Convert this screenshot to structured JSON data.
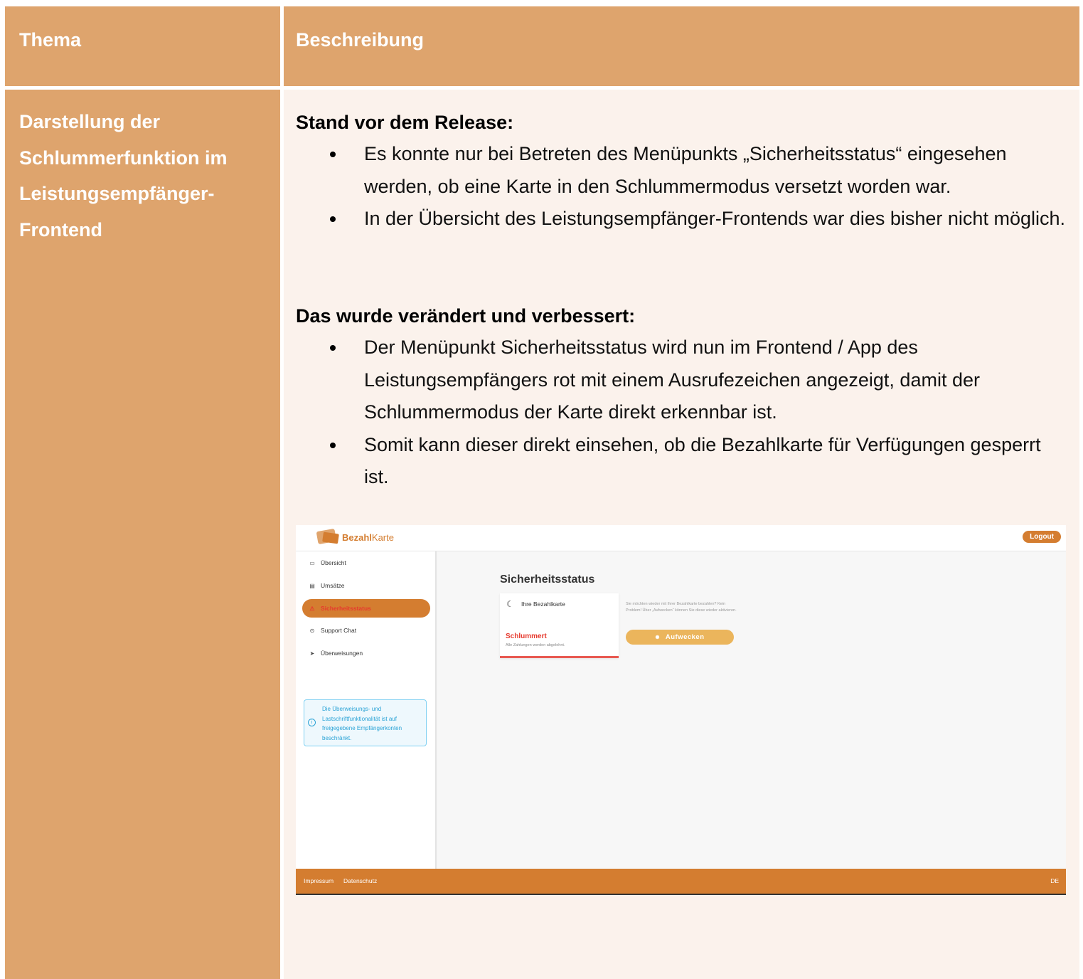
{
  "table": {
    "headers": {
      "topic": "Thema",
      "description": "Beschreibung"
    },
    "topic": "Darstellung der Schlummerfunktion im Leistungsempfänger-Frontend",
    "before": {
      "title": "Stand vor dem Release:",
      "bullets": [
        "Es konnte nur bei Betreten des Menüpunkts „Sicherheitsstatus“ eingesehen werden, ob eine Karte in den Schlummermodus versetzt worden war.",
        "In der Übersicht des Leistungsempfänger-Frontends war dies bisher nicht möglich."
      ]
    },
    "after": {
      "title": "Das wurde verändert und verbessert:",
      "bullets": [
        "Der Menüpunkt Sicherheitsstatus wird nun im Frontend / App des Leistungsempfängers rot mit einem Ausrufezeichen angezeigt, damit der Schlummermodus der Karte direkt erkennbar ist.",
        "Somit kann dieser direkt einsehen, ob die Bezahlkarte für Verfügungen gesperrt ist."
      ]
    }
  },
  "app": {
    "logo_bold": "Bezahl",
    "logo_rest": "Karte",
    "logout": "Logout",
    "nav": [
      {
        "label": "Übersicht",
        "icon": "card-icon"
      },
      {
        "label": "Umsätze",
        "icon": "receipt-icon"
      },
      {
        "label": "Sicherheitsstatus",
        "icon": "warning-icon",
        "active": true
      },
      {
        "label": "Support Chat",
        "icon": "help-icon"
      },
      {
        "label": "Überweisungen",
        "icon": "send-icon"
      }
    ],
    "info": "Die Überweisungs- und Lastschriftfunktionalität ist auf freigegebene Empfängerkonten beschränkt.",
    "page_title": "Sicherheitsstatus",
    "card_label": "Ihre Bezahlkarte",
    "card_status": "Schlummert",
    "card_sub": "Alle Zahlungen werden abgelehnt.",
    "hint": "Sie möchten wieder mit Ihrer Bezahlkarte bezahlen? Kein Problem! Über „Aufwecken“ können Sie diese wieder aktivieren.",
    "wake_button": "Aufwecken",
    "footer": {
      "impressum": "Impressum",
      "datenschutz": "Datenschutz",
      "lang": "DE"
    },
    "colors": {
      "accent": "#d47d30",
      "alert": "#e63a2e",
      "button": "#ebb55c",
      "info": "#2aa3d6"
    }
  },
  "colors": {
    "header_bg": "#dea46d",
    "body_bg": "#fbf2ec"
  }
}
